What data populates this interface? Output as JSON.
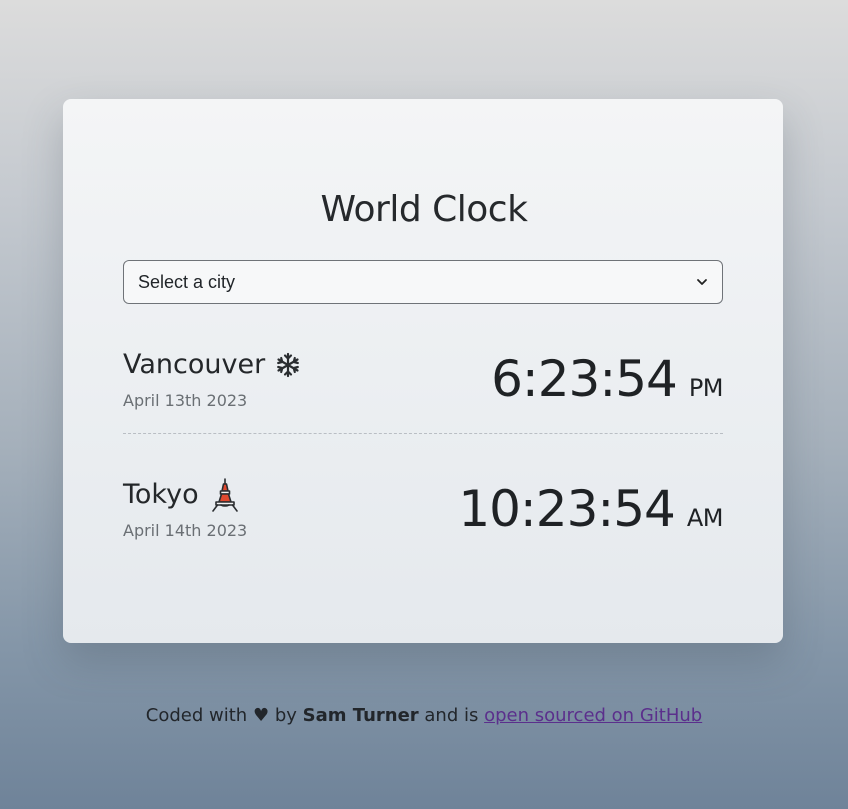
{
  "app": {
    "title": "World Clock"
  },
  "city_select": {
    "selected": "Select a city"
  },
  "cities": [
    {
      "name": "Vancouver",
      "icon": "snowflake-icon",
      "date": "April 13th 2023",
      "time": "6:23:54",
      "period": "PM"
    },
    {
      "name": "Tokyo",
      "icon": "tokyo-tower-icon",
      "date": "April 14th 2023",
      "time": "10:23:54",
      "period": "AM"
    }
  ],
  "footer": {
    "prefix": "Coded with",
    "heart": "♥",
    "by": "by",
    "author": "Sam Turner",
    "middle": "and is",
    "link_text": "open sourced on GitHub"
  },
  "colors": {
    "link": "#5b2f8c",
    "tower": "#e0492f"
  }
}
